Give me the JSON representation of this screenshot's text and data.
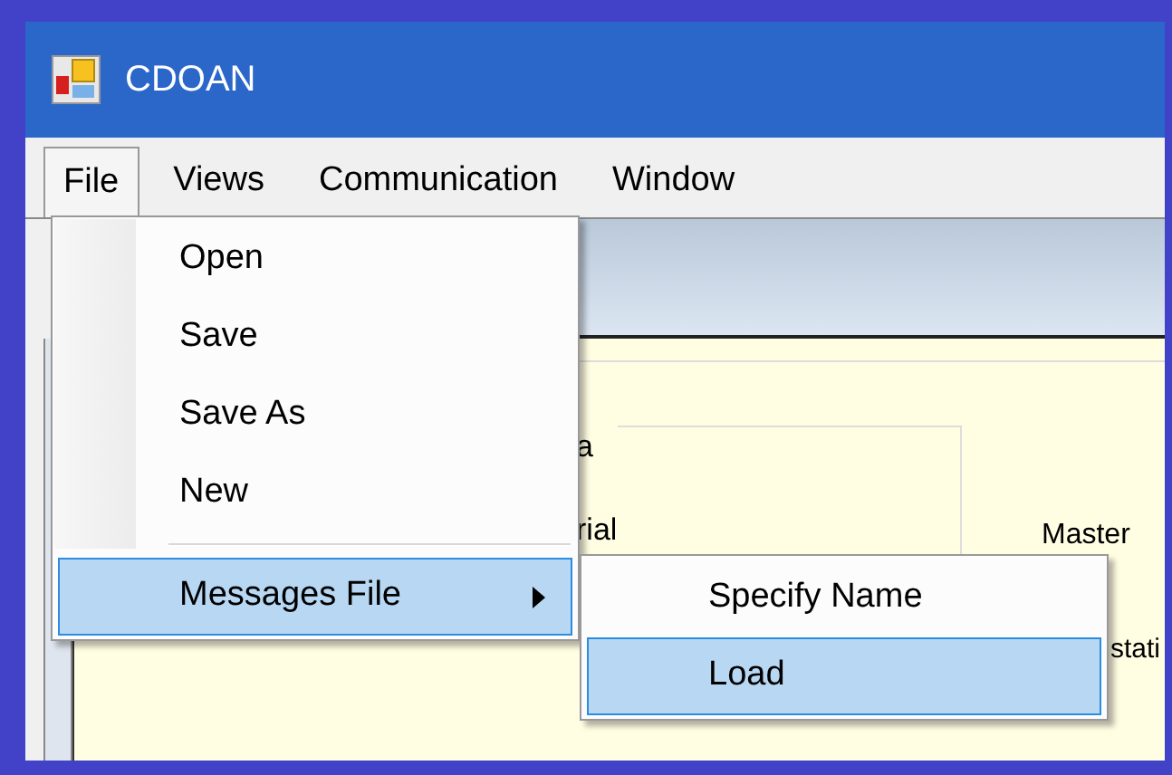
{
  "window": {
    "title": "CDOAN"
  },
  "menu_bar": [
    {
      "label": "File",
      "selected": true
    },
    {
      "label": "Views",
      "selected": false
    },
    {
      "label": "Communication",
      "selected": false
    },
    {
      "label": "Window",
      "selected": false
    }
  ],
  "file_menu": [
    {
      "kind": "item",
      "label": "Open",
      "selected": false
    },
    {
      "kind": "item",
      "label": "Save",
      "selected": false
    },
    {
      "kind": "item",
      "label": "Save As",
      "selected": false
    },
    {
      "kind": "item",
      "label": "New",
      "selected": false
    },
    {
      "kind": "separator"
    },
    {
      "kind": "submenu",
      "label": "Messages File",
      "selected": true
    }
  ],
  "submenu": [
    {
      "label": "Specify Name",
      "selected": false
    },
    {
      "label": "Load",
      "selected": true
    }
  ],
  "background_labels": [
    "a",
    "rial",
    "Master",
    "stati"
  ]
}
